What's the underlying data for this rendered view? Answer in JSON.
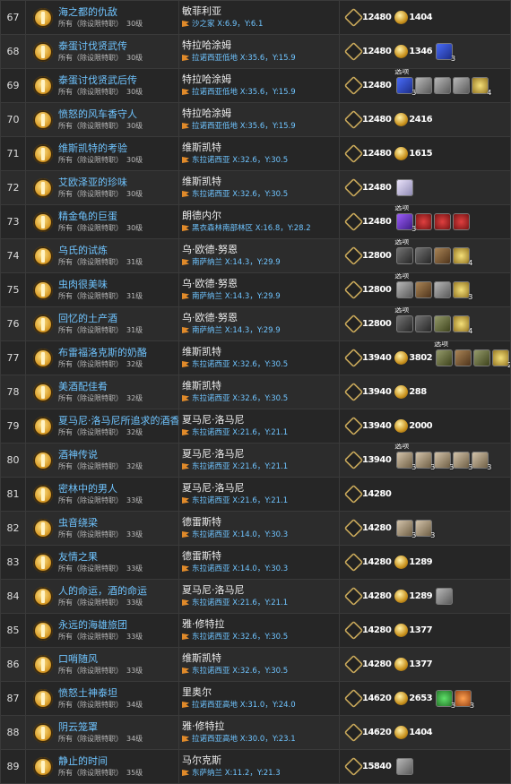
{
  "option_label": "选项",
  "rows": [
    {
      "num": "67",
      "name": "海之都的仇敌",
      "sub": "所有（除设限特职）",
      "level": "30级",
      "npc": "敏菲利亚",
      "loc": "沙之家 X:6.9，Y:6.1",
      "exp": "12480",
      "gil": "1404",
      "items": []
    },
    {
      "num": "68",
      "name": "泰蛋讨伐贤武传",
      "sub": "所有（除设限特职）",
      "level": "30级",
      "npc": "特拉哈涂姆",
      "loc": "拉诺西亚低地 X:35.6，Y:15.9",
      "exp": "12480",
      "gil": "1346",
      "items": [
        {
          "c": "i-blue",
          "n": "3"
        }
      ]
    },
    {
      "num": "69",
      "name": "泰蛋讨伐贤武后传",
      "sub": "所有（除设限特职）",
      "level": "30级",
      "npc": "特拉哈涂姆",
      "loc": "拉诺西亚低地 X:35.6，Y:15.9",
      "exp": "12480",
      "gil": "",
      "option": true,
      "items": [
        {
          "c": "i-blue",
          "n": "3"
        },
        {
          "c": "i-gray",
          "n": ""
        },
        {
          "c": "i-gray",
          "n": ""
        },
        {
          "c": "i-gray",
          "n": ""
        },
        {
          "c": "i-gold",
          "n": "4"
        }
      ]
    },
    {
      "num": "70",
      "name": "愤怒的风车香守人",
      "sub": "所有（除设限特职）",
      "level": "30级",
      "npc": "特拉哈涂姆",
      "loc": "拉诺西亚低地 X:35.6，Y:15.9",
      "exp": "12480",
      "gil": "2416",
      "items": []
    },
    {
      "num": "71",
      "name": "维斯凯特的考验",
      "sub": "所有（除设限特职）",
      "level": "30级",
      "npc": "维斯凯特",
      "loc": "东拉诺西亚 X:32.6，Y:30.5",
      "exp": "12480",
      "gil": "1615",
      "items": []
    },
    {
      "num": "72",
      "name": "艾欧泽亚的珍味",
      "sub": "所有（除设限特职）",
      "level": "30级",
      "npc": "维斯凯特",
      "loc": "东拉诺西亚 X:32.6，Y:30.5",
      "exp": "12480",
      "gil": "",
      "items": [
        {
          "c": "i-crystal",
          "n": ""
        }
      ]
    },
    {
      "num": "73",
      "name": "精金龟的巨蛋",
      "sub": "所有（除设限特职）",
      "level": "30级",
      "npc": "朗德内尔",
      "loc": "黑衣森林南部林区 X:16.8，Y:28.2",
      "exp": "12480",
      "gil": "",
      "option": true,
      "items": [
        {
          "c": "i-purple",
          "n": "3"
        },
        {
          "c": "i-red",
          "n": ""
        },
        {
          "c": "i-red",
          "n": ""
        },
        {
          "c": "i-red",
          "n": ""
        }
      ]
    },
    {
      "num": "74",
      "name": "乌氏的试炼",
      "sub": "所有（除设限特职）",
      "level": "31级",
      "npc": "乌·欧德·努恩",
      "loc": "南萨纳兰 X:14.3，Y:29.9",
      "exp": "12800",
      "gil": "",
      "option": true,
      "items": [
        {
          "c": "i-dark",
          "n": ""
        },
        {
          "c": "i-dark",
          "n": ""
        },
        {
          "c": "i-brown",
          "n": ""
        },
        {
          "c": "i-gold",
          "n": "4"
        }
      ]
    },
    {
      "num": "75",
      "name": "虫肉很美味",
      "sub": "所有（除设限特职）",
      "level": "31级",
      "npc": "乌·欧德·努恩",
      "loc": "南萨纳兰 X:14.3，Y:29.9",
      "exp": "12800",
      "gil": "",
      "option": true,
      "items": [
        {
          "c": "i-gray",
          "n": ""
        },
        {
          "c": "i-brown",
          "n": ""
        },
        {
          "c": "i-gray",
          "n": ""
        },
        {
          "c": "i-gold",
          "n": "3"
        }
      ]
    },
    {
      "num": "76",
      "name": "回忆的土产酒",
      "sub": "所有（除设限特职）",
      "level": "31级",
      "npc": "乌·欧德·努恩",
      "loc": "南萨纳兰 X:14.3，Y:29.9",
      "exp": "12800",
      "gil": "",
      "option": true,
      "items": [
        {
          "c": "i-dark",
          "n": ""
        },
        {
          "c": "i-dark",
          "n": ""
        },
        {
          "c": "i-olive",
          "n": ""
        },
        {
          "c": "i-gold",
          "n": "4"
        }
      ]
    },
    {
      "num": "77",
      "name": "布雷福洛克斯的奶酪",
      "sub": "所有（除设限特职）",
      "level": "32级",
      "npc": "维斯凯特",
      "loc": "东拉诺西亚 X:32.6，Y:30.5",
      "exp": "13940",
      "gil": "3802",
      "option": true,
      "items": [
        {
          "c": "i-olive",
          "n": ""
        },
        {
          "c": "i-brown",
          "n": ""
        },
        {
          "c": "i-olive",
          "n": ""
        },
        {
          "c": "i-gold",
          "n": "2"
        }
      ]
    },
    {
      "num": "78",
      "name": "美酒配佳肴",
      "sub": "所有（除设限特职）",
      "level": "32级",
      "npc": "维斯凯特",
      "loc": "东拉诺西亚 X:32.6，Y:30.5",
      "exp": "13940",
      "gil": "288",
      "items": []
    },
    {
      "num": "79",
      "name": "夏马尼·洛马尼所追求的酒香",
      "sub": "所有（除设限特职）",
      "level": "32级",
      "npc": "夏马尼·洛马尼",
      "loc": "东拉诺西亚 X:21.6，Y:21.1",
      "exp": "13940",
      "gil": "2000",
      "items": []
    },
    {
      "num": "80",
      "name": "酒神传说",
      "sub": "所有（除设限特职）",
      "level": "32级",
      "npc": "夏马尼·洛马尼",
      "loc": "东拉诺西亚 X:21.6，Y:21.1",
      "exp": "13940",
      "gil": "",
      "option": true,
      "items": [
        {
          "c": "i-potion",
          "n": "3"
        },
        {
          "c": "i-potion",
          "n": "3"
        },
        {
          "c": "i-potion",
          "n": "3"
        },
        {
          "c": "i-potion",
          "n": "3"
        },
        {
          "c": "i-potion",
          "n": "3"
        }
      ]
    },
    {
      "num": "81",
      "name": "密林中的男人",
      "sub": "所有（除设限特职）",
      "level": "33级",
      "npc": "夏马尼·洛马尼",
      "loc": "东拉诺西亚 X:21.6，Y:21.1",
      "exp": "14280",
      "gil": "",
      "items": []
    },
    {
      "num": "82",
      "name": "虫音绕梁",
      "sub": "所有（除设限特职）",
      "level": "33级",
      "npc": "德雷斯特",
      "loc": "东拉诺西亚 X:14.0，Y:30.3",
      "exp": "14280",
      "gil": "",
      "items": [
        {
          "c": "i-potion",
          "n": "3"
        },
        {
          "c": "i-potion",
          "n": "3"
        }
      ]
    },
    {
      "num": "83",
      "name": "友情之果",
      "sub": "所有（除设限特职）",
      "level": "33级",
      "npc": "德雷斯特",
      "loc": "东拉诺西亚 X:14.0，Y:30.3",
      "exp": "14280",
      "gil": "1289",
      "items": []
    },
    {
      "num": "84",
      "name": "人的命运，酒的命运",
      "sub": "所有（除设限特职）",
      "level": "33级",
      "npc": "夏马尼·洛马尼",
      "loc": "东拉诺西亚 X:21.6，Y:21.1",
      "exp": "14280",
      "gil": "1289",
      "items": [
        {
          "c": "i-gray",
          "n": ""
        }
      ]
    },
    {
      "num": "85",
      "name": "永远的海雄旅团",
      "sub": "所有（除设限特职）",
      "level": "33级",
      "npc": "雅·修特拉",
      "loc": "东拉诺西亚 X:32.6，Y:30.5",
      "exp": "14280",
      "gil": "1377",
      "items": []
    },
    {
      "num": "86",
      "name": "口哨随风",
      "sub": "所有（除设限特职）",
      "level": "33级",
      "npc": "维斯凯特",
      "loc": "东拉诺西亚 X:32.6，Y:30.5",
      "exp": "14280",
      "gil": "1377",
      "items": []
    },
    {
      "num": "87",
      "name": "愤怒土神泰坦",
      "sub": "所有（除设限特职）",
      "level": "34级",
      "npc": "里奥尔",
      "loc": "拉诺西亚高地 X:31.0，Y:24.0",
      "exp": "14620",
      "gil": "2653",
      "items": [
        {
          "c": "i-green",
          "n": "3"
        },
        {
          "c": "i-orange",
          "n": "3"
        }
      ]
    },
    {
      "num": "88",
      "name": "阴云笼罩",
      "sub": "所有（除设限特职）",
      "level": "34级",
      "npc": "雅·修特拉",
      "loc": "拉诺西亚高地 X:30.0，Y:23.1",
      "exp": "14620",
      "gil": "1404",
      "items": []
    },
    {
      "num": "89",
      "name": "静止的时间",
      "sub": "所有（除设限特职）",
      "level": "35级",
      "npc": "马尔克斯",
      "loc": "东萨纳兰 X:11.2，Y:21.3",
      "exp": "15840",
      "gil": "",
      "items": [
        {
          "c": "i-gray",
          "n": ""
        }
      ]
    }
  ]
}
